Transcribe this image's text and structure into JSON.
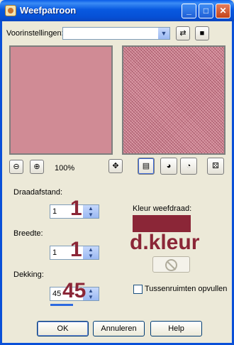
{
  "window": {
    "title": "Weefpatroon",
    "min": "_",
    "max": "□",
    "close": "✕"
  },
  "presets": {
    "label": "Voorinstellingen:",
    "value": ""
  },
  "toolbar": {
    "zoom": "100%"
  },
  "fields": {
    "gap": {
      "label": "Draadafstand:",
      "value": "1",
      "overlay": "1"
    },
    "width": {
      "label": "Breedte:",
      "value": "1",
      "overlay": "1"
    },
    "opacity": {
      "label": "Dekking:",
      "value": "45",
      "overlay": "45"
    }
  },
  "color": {
    "label": "Kleur weefdraad:",
    "swatch": "#8b2637",
    "overlay": "d.kleur"
  },
  "fill_gaps": {
    "label": "Tussenruimten opvullen",
    "checked": false
  },
  "buttons": {
    "ok": "OK",
    "cancel": "Annuleren",
    "help": "Help"
  },
  "icons": [
    "zoom-out-icon",
    "zoom-in-icon",
    "move-icon",
    "preview-toggle-icon",
    "proof-icon",
    "auto-proof-icon",
    "randomize-icon",
    "save-preset-icon",
    "load-preset-icon"
  ]
}
